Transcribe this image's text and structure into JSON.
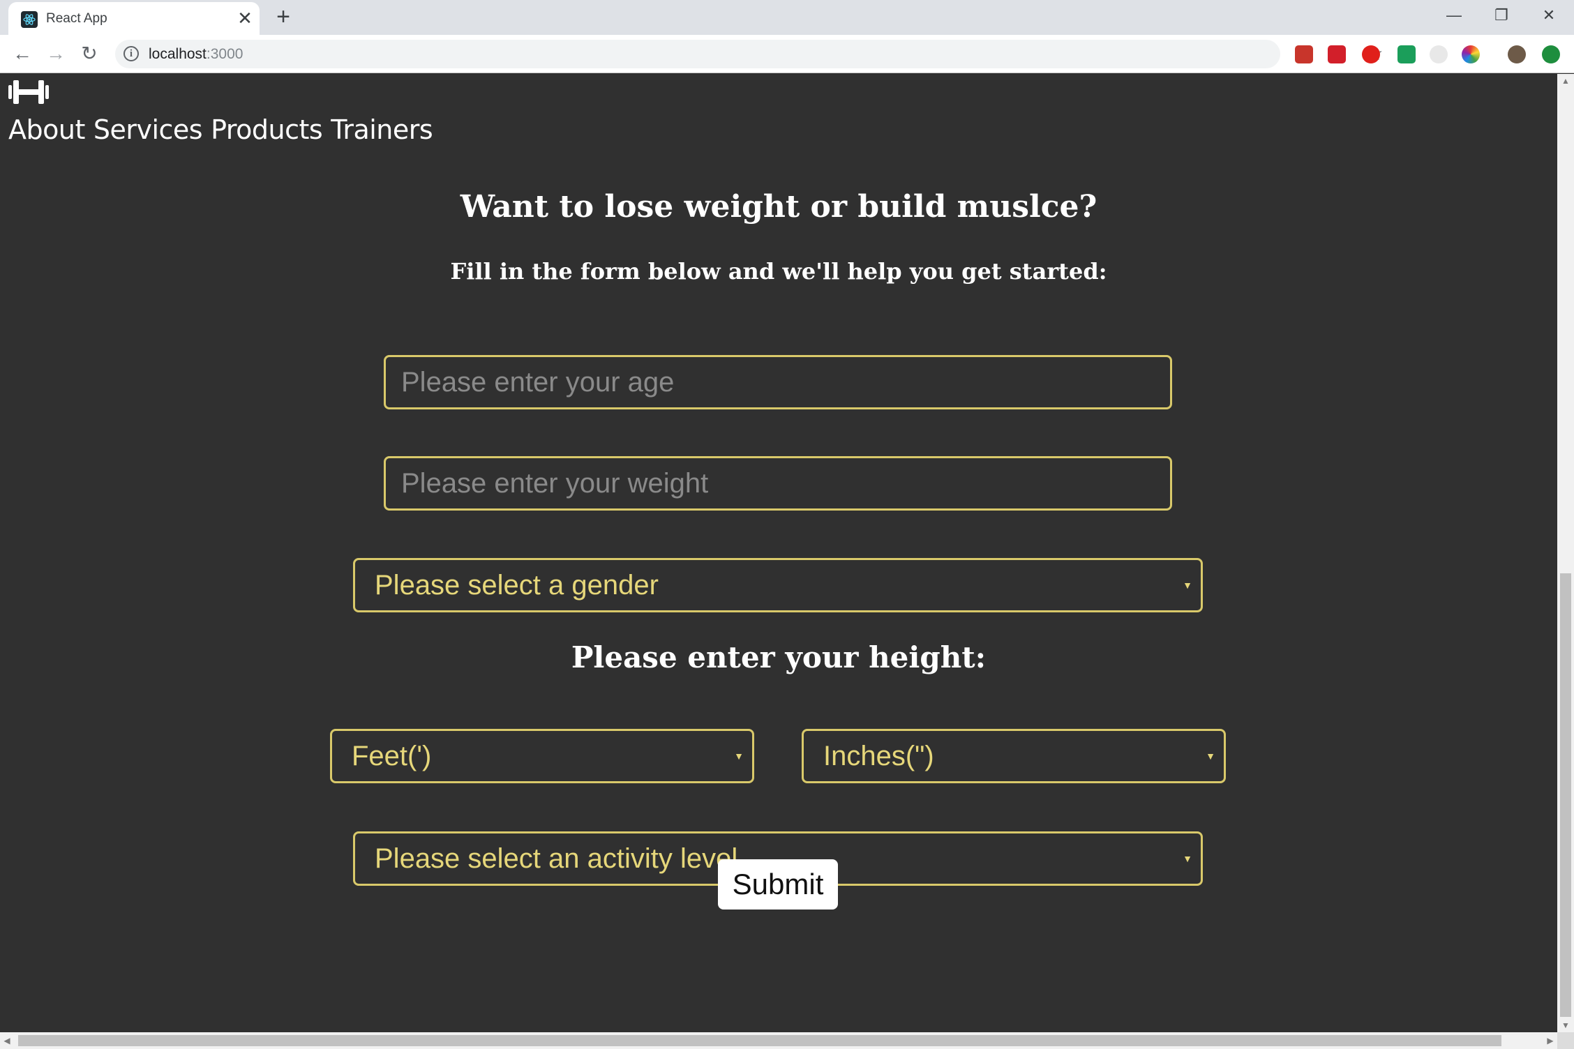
{
  "browser": {
    "tab_title": "React App",
    "tab_close": "✕",
    "new_tab": "+",
    "url_host": "localhost",
    "url_port": ":3000",
    "window_controls": {
      "minimize": "—",
      "restore": "❐",
      "close": "✕"
    },
    "nav": {
      "back": "←",
      "forward": "→",
      "reload": "↻"
    },
    "info": "i",
    "star": "☆"
  },
  "site": {
    "logo_icon": "dumbbell-icon",
    "nav_links": [
      "About",
      "Services",
      "Products",
      "Trainers"
    ]
  },
  "form": {
    "heading": "Want to lose weight or build muslce?",
    "subheading": "Fill in the form below and we'll help you get started:",
    "age_placeholder": "Please enter your age",
    "weight_placeholder": "Please enter your weight",
    "gender_select": "Please select a gender",
    "height_label": "Please enter your height:",
    "feet_select": "Feet(')",
    "inches_select": "Inches(\")",
    "activity_select": "Please select an activity level",
    "submit_label": "Submit"
  },
  "colors": {
    "page_bg": "#303030",
    "accent_border": "#d9c96a",
    "select_text": "#e6d77a"
  }
}
